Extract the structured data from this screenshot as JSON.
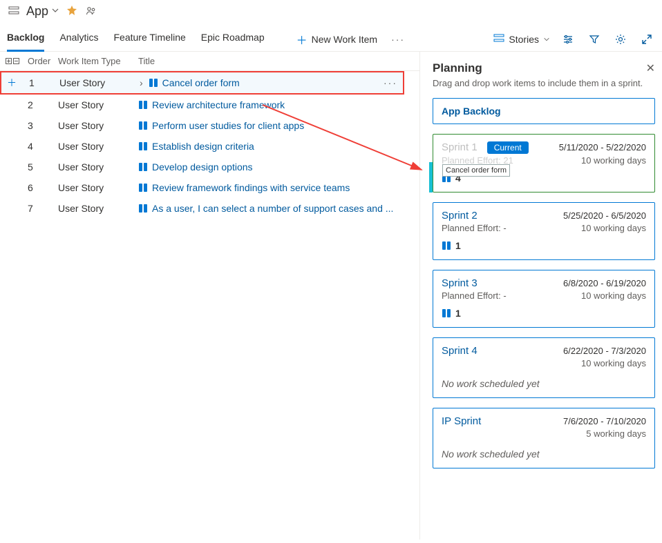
{
  "header": {
    "app_name": "App"
  },
  "tabs": [
    {
      "label": "Backlog",
      "active": true
    },
    {
      "label": "Analytics"
    },
    {
      "label": "Feature Timeline"
    },
    {
      "label": "Epic Roadmap"
    }
  ],
  "toolbar": {
    "new_item": "New Work Item",
    "view_select": "Stories"
  },
  "columns": {
    "order": "Order",
    "type": "Work Item Type",
    "title": "Title"
  },
  "backlog": [
    {
      "order": "1",
      "type": "User Story",
      "title": "Cancel order form",
      "selected": true
    },
    {
      "order": "2",
      "type": "User Story",
      "title": "Review architecture framework"
    },
    {
      "order": "3",
      "type": "User Story",
      "title": "Perform user studies for client apps"
    },
    {
      "order": "4",
      "type": "User Story",
      "title": "Establish design criteria"
    },
    {
      "order": "5",
      "type": "User Story",
      "title": "Develop design options"
    },
    {
      "order": "6",
      "type": "User Story",
      "title": "Review framework findings with service teams"
    },
    {
      "order": "7",
      "type": "User Story",
      "title": "As a user, I can select a number of support cases and ..."
    }
  ],
  "planning": {
    "title": "Planning",
    "subtitle": "Drag and drop work items to include them in a sprint.",
    "backlog_bucket": "App Backlog",
    "ghost": "Cancel order form",
    "sprints": [
      {
        "name": "Sprint 1",
        "current": true,
        "effort_label": "Planned Effort: 21",
        "dates": "5/11/2020 - 5/22/2020",
        "days": "10 working days",
        "count": "4",
        "green": true,
        "dim": true
      },
      {
        "name": "Sprint 2",
        "effort_label": "Planned Effort: -",
        "dates": "5/25/2020 - 6/5/2020",
        "days": "10 working days",
        "count": "1"
      },
      {
        "name": "Sprint 3",
        "effort_label": "Planned Effort: -",
        "dates": "6/8/2020 - 6/19/2020",
        "days": "10 working days",
        "count": "1"
      },
      {
        "name": "Sprint 4",
        "dates": "6/22/2020 - 7/3/2020",
        "days": "10 working days",
        "nowork": "No work scheduled yet"
      },
      {
        "name": "IP Sprint",
        "dates": "7/6/2020 - 7/10/2020",
        "days": "5 working days",
        "nowork": "No work scheduled yet"
      }
    ],
    "current_label": "Current"
  }
}
